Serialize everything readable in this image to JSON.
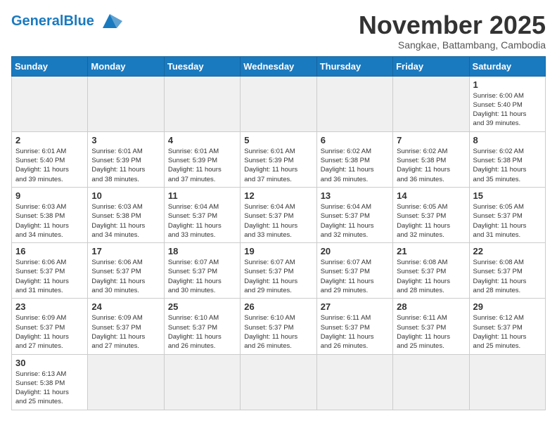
{
  "header": {
    "logo_general": "General",
    "logo_blue": "Blue",
    "month": "November 2025",
    "location": "Sangkae, Battambang, Cambodia"
  },
  "days_of_week": [
    "Sunday",
    "Monday",
    "Tuesday",
    "Wednesday",
    "Thursday",
    "Friday",
    "Saturday"
  ],
  "weeks": [
    [
      {
        "day": "",
        "info": ""
      },
      {
        "day": "",
        "info": ""
      },
      {
        "day": "",
        "info": ""
      },
      {
        "day": "",
        "info": ""
      },
      {
        "day": "",
        "info": ""
      },
      {
        "day": "",
        "info": ""
      },
      {
        "day": "1",
        "info": "Sunrise: 6:00 AM\nSunset: 5:40 PM\nDaylight: 11 hours\nand 39 minutes."
      }
    ],
    [
      {
        "day": "2",
        "info": "Sunrise: 6:01 AM\nSunset: 5:40 PM\nDaylight: 11 hours\nand 39 minutes."
      },
      {
        "day": "3",
        "info": "Sunrise: 6:01 AM\nSunset: 5:39 PM\nDaylight: 11 hours\nand 38 minutes."
      },
      {
        "day": "4",
        "info": "Sunrise: 6:01 AM\nSunset: 5:39 PM\nDaylight: 11 hours\nand 37 minutes."
      },
      {
        "day": "5",
        "info": "Sunrise: 6:01 AM\nSunset: 5:39 PM\nDaylight: 11 hours\nand 37 minutes."
      },
      {
        "day": "6",
        "info": "Sunrise: 6:02 AM\nSunset: 5:38 PM\nDaylight: 11 hours\nand 36 minutes."
      },
      {
        "day": "7",
        "info": "Sunrise: 6:02 AM\nSunset: 5:38 PM\nDaylight: 11 hours\nand 36 minutes."
      },
      {
        "day": "8",
        "info": "Sunrise: 6:02 AM\nSunset: 5:38 PM\nDaylight: 11 hours\nand 35 minutes."
      }
    ],
    [
      {
        "day": "9",
        "info": "Sunrise: 6:03 AM\nSunset: 5:38 PM\nDaylight: 11 hours\nand 34 minutes."
      },
      {
        "day": "10",
        "info": "Sunrise: 6:03 AM\nSunset: 5:38 PM\nDaylight: 11 hours\nand 34 minutes."
      },
      {
        "day": "11",
        "info": "Sunrise: 6:04 AM\nSunset: 5:37 PM\nDaylight: 11 hours\nand 33 minutes."
      },
      {
        "day": "12",
        "info": "Sunrise: 6:04 AM\nSunset: 5:37 PM\nDaylight: 11 hours\nand 33 minutes."
      },
      {
        "day": "13",
        "info": "Sunrise: 6:04 AM\nSunset: 5:37 PM\nDaylight: 11 hours\nand 32 minutes."
      },
      {
        "day": "14",
        "info": "Sunrise: 6:05 AM\nSunset: 5:37 PM\nDaylight: 11 hours\nand 32 minutes."
      },
      {
        "day": "15",
        "info": "Sunrise: 6:05 AM\nSunset: 5:37 PM\nDaylight: 11 hours\nand 31 minutes."
      }
    ],
    [
      {
        "day": "16",
        "info": "Sunrise: 6:06 AM\nSunset: 5:37 PM\nDaylight: 11 hours\nand 31 minutes."
      },
      {
        "day": "17",
        "info": "Sunrise: 6:06 AM\nSunset: 5:37 PM\nDaylight: 11 hours\nand 30 minutes."
      },
      {
        "day": "18",
        "info": "Sunrise: 6:07 AM\nSunset: 5:37 PM\nDaylight: 11 hours\nand 30 minutes."
      },
      {
        "day": "19",
        "info": "Sunrise: 6:07 AM\nSunset: 5:37 PM\nDaylight: 11 hours\nand 29 minutes."
      },
      {
        "day": "20",
        "info": "Sunrise: 6:07 AM\nSunset: 5:37 PM\nDaylight: 11 hours\nand 29 minutes."
      },
      {
        "day": "21",
        "info": "Sunrise: 6:08 AM\nSunset: 5:37 PM\nDaylight: 11 hours\nand 28 minutes."
      },
      {
        "day": "22",
        "info": "Sunrise: 6:08 AM\nSunset: 5:37 PM\nDaylight: 11 hours\nand 28 minutes."
      }
    ],
    [
      {
        "day": "23",
        "info": "Sunrise: 6:09 AM\nSunset: 5:37 PM\nDaylight: 11 hours\nand 27 minutes."
      },
      {
        "day": "24",
        "info": "Sunrise: 6:09 AM\nSunset: 5:37 PM\nDaylight: 11 hours\nand 27 minutes."
      },
      {
        "day": "25",
        "info": "Sunrise: 6:10 AM\nSunset: 5:37 PM\nDaylight: 11 hours\nand 26 minutes."
      },
      {
        "day": "26",
        "info": "Sunrise: 6:10 AM\nSunset: 5:37 PM\nDaylight: 11 hours\nand 26 minutes."
      },
      {
        "day": "27",
        "info": "Sunrise: 6:11 AM\nSunset: 5:37 PM\nDaylight: 11 hours\nand 26 minutes."
      },
      {
        "day": "28",
        "info": "Sunrise: 6:11 AM\nSunset: 5:37 PM\nDaylight: 11 hours\nand 25 minutes."
      },
      {
        "day": "29",
        "info": "Sunrise: 6:12 AM\nSunset: 5:37 PM\nDaylight: 11 hours\nand 25 minutes."
      }
    ],
    [
      {
        "day": "30",
        "info": "Sunrise: 6:13 AM\nSunset: 5:38 PM\nDaylight: 11 hours\nand 25 minutes."
      },
      {
        "day": "",
        "info": ""
      },
      {
        "day": "",
        "info": ""
      },
      {
        "day": "",
        "info": ""
      },
      {
        "day": "",
        "info": ""
      },
      {
        "day": "",
        "info": ""
      },
      {
        "day": "",
        "info": ""
      }
    ]
  ]
}
